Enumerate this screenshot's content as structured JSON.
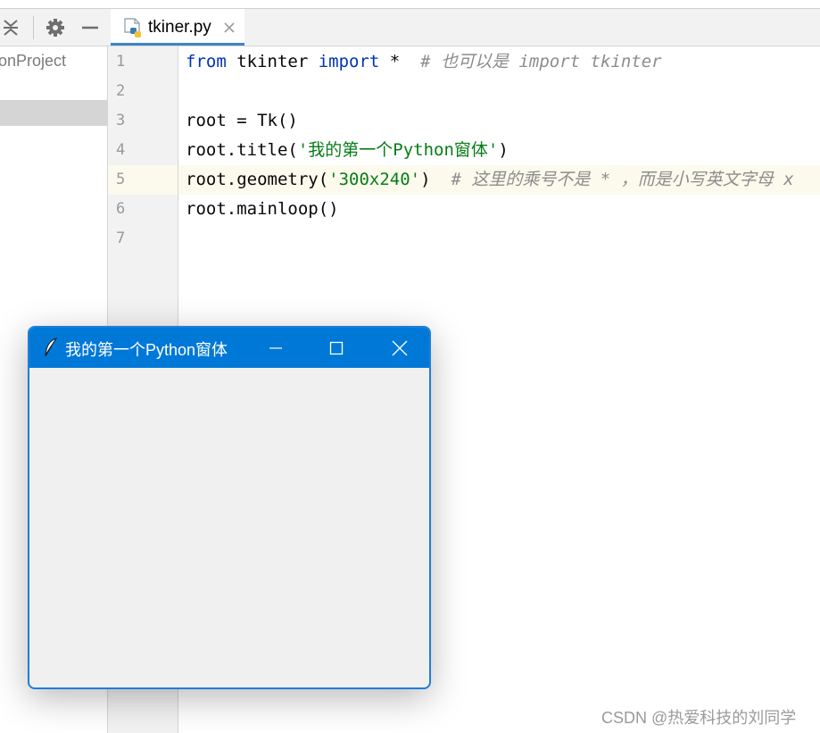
{
  "sidebar": {
    "project_label": "onProject",
    "toolbar": {
      "collapse_icon": "collapse-all-icon",
      "settings_icon": "gear-icon",
      "hide_icon": "minimize-icon"
    }
  },
  "editor_tab": {
    "label": "tkiner.py",
    "icon": "python-file-icon",
    "close_icon": "close-icon"
  },
  "editor": {
    "line_numbers": [
      "1",
      "2",
      "3",
      "4",
      "5",
      "6",
      "7"
    ],
    "current_line": "5",
    "code": {
      "line1_kw1": "from",
      "line1_mid": " tkinter ",
      "line1_kw2": "import",
      "line1_star": " *  ",
      "line1_comment": "# 也可以是 import tkinter",
      "line3": "root = Tk()",
      "line4_pre": "root.title(",
      "line4_str": "'我的第一个Python窗体'",
      "line4_post": ")",
      "line5_pre": "root.geometry(",
      "line5_str": "'300x240'",
      "line5_post": ")  ",
      "line5_comment": "# 这里的乘号不是 * ，而是小写英文字母 x",
      "line6": "root.mainloop()"
    }
  },
  "tk_window": {
    "title": "我的第一个Python窗体",
    "icon": "feather-icon",
    "accent_color": "#0078d7",
    "body_color": "#f0f0f0"
  },
  "watermark": "CSDN @热爱科技的刘同学"
}
